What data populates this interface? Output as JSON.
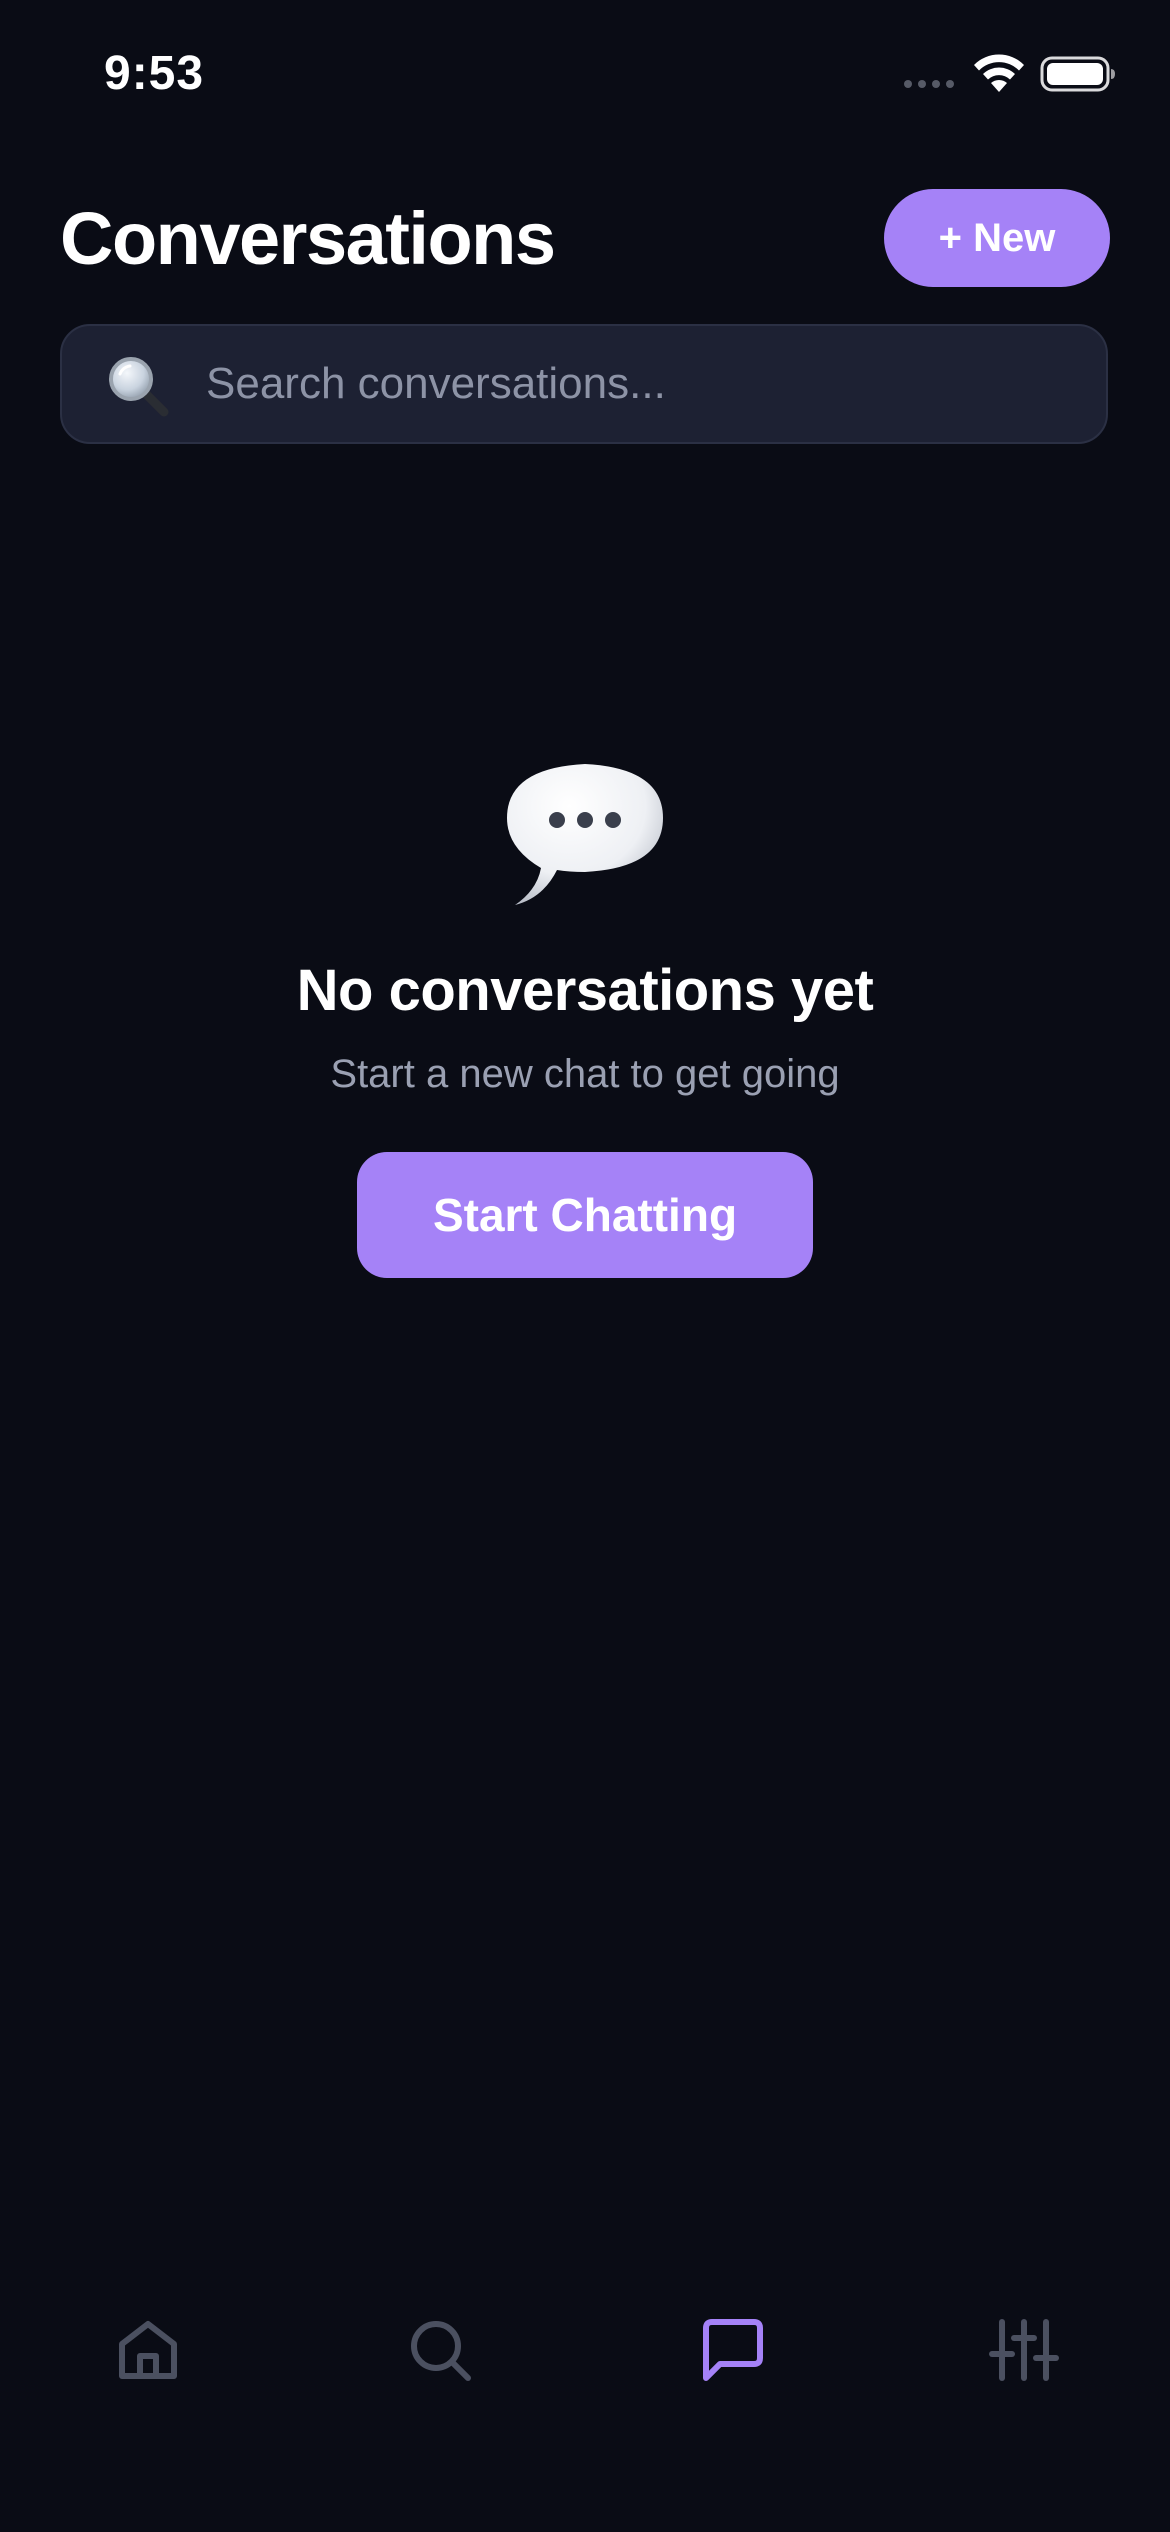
{
  "status_bar": {
    "time": "9:53"
  },
  "header": {
    "title": "Conversations",
    "new_button_label": "+ New"
  },
  "search": {
    "placeholder": "Search conversations...",
    "value": ""
  },
  "empty_state": {
    "title": "No conversations yet",
    "subtitle": "Start a new chat to get going",
    "button_label": "Start Chatting"
  },
  "tab_bar": {
    "active_tab": "chats",
    "tabs": [
      {
        "id": "home",
        "icon": "home-icon"
      },
      {
        "id": "search",
        "icon": "search-icon"
      },
      {
        "id": "chats",
        "icon": "chat-bubble-icon"
      },
      {
        "id": "settings",
        "icon": "sliders-icon"
      }
    ]
  },
  "colors": {
    "background": "#0a0c15",
    "accent": "#a582f7",
    "search_bg": "#1d2133",
    "inactive_icon": "#4b5060",
    "muted_text": "#9aa0b2"
  }
}
